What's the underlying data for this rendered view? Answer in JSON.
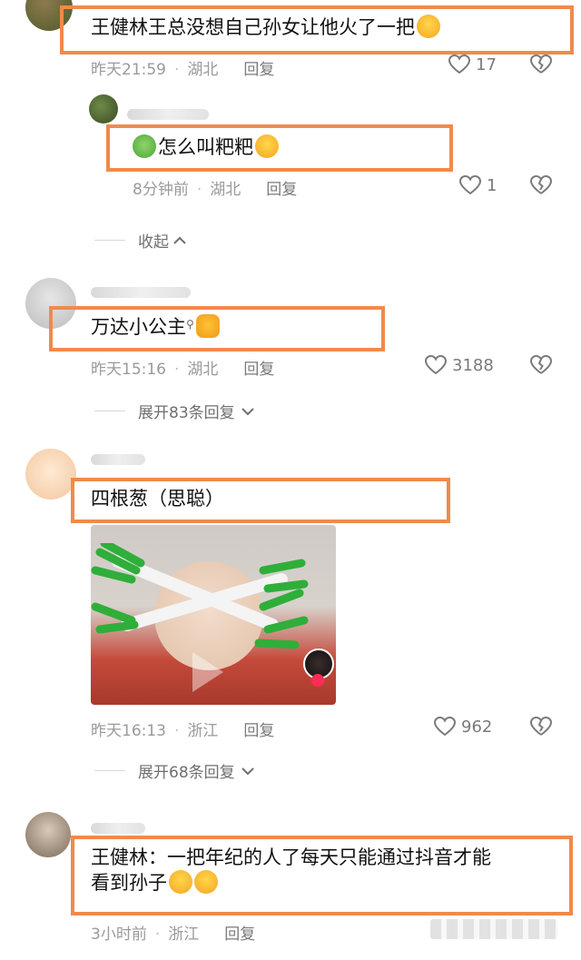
{
  "comments": [
    {
      "text": "王健林王总没想自己孙女让他火了一把",
      "time": "昨天21:59",
      "location": "湖北",
      "reply": "回复",
      "likes": "17"
    },
    {
      "text": "怎么叫粑粑",
      "time": "8分钟前",
      "location": "湖北",
      "reply": "回复",
      "likes": "1",
      "collapse": "收起"
    },
    {
      "text": "万达小公主",
      "time": "昨天15:16",
      "location": "湖北",
      "reply": "回复",
      "likes": "3188",
      "expand": "展开83条回复"
    },
    {
      "text": "四根葱（思聪）",
      "time": "昨天16:13",
      "location": "浙江",
      "reply": "回复",
      "likes": "962",
      "expand": "展开68条回复"
    },
    {
      "text_line1": "王健林：一把年纪的人了每天只能通过抖音才能",
      "text_line2": "看到孙子",
      "time": "3小时前",
      "location": "浙江",
      "reply": "回复"
    }
  ],
  "colors": {
    "highlight": "#f08a4b",
    "meta": "#9a9a9a"
  }
}
